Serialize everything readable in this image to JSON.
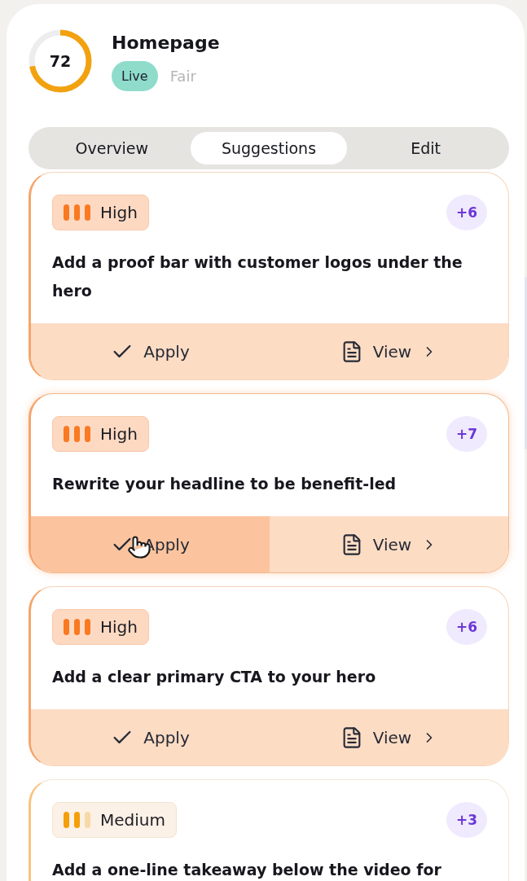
{
  "page": {
    "title": "Homepage",
    "status": "Live",
    "rating": "Fair",
    "score": {
      "value": "72",
      "level": 0.72
    }
  },
  "tabs": [
    {
      "label": "Overview",
      "selected": false
    },
    {
      "label": "Suggestions",
      "selected": true
    },
    {
      "label": "Edit",
      "selected": false
    }
  ],
  "suggestions": [
    {
      "priority": {
        "kind": "high",
        "label": "High"
      },
      "points": "+6",
      "text": "Add a proof bar with customer logos under the hero",
      "hovered": false,
      "actions": {
        "apply": "Apply",
        "view": "View"
      }
    },
    {
      "priority": {
        "kind": "high",
        "label": "High"
      },
      "points": "+7",
      "text": "Rewrite your headline to be benefit-led",
      "hovered": true,
      "actions": {
        "apply": "Apply",
        "view": "View"
      }
    },
    {
      "priority": {
        "kind": "high",
        "label": "High"
      },
      "points": "+6",
      "text": "Add a clear primary CTA to your hero",
      "hovered": false,
      "actions": {
        "apply": "Apply",
        "view": "View"
      }
    },
    {
      "priority": {
        "kind": "medium",
        "label": "Medium"
      },
      "points": "+3",
      "text": "Add a one-line takeaway below the video for",
      "hovered": false
    }
  ]
}
